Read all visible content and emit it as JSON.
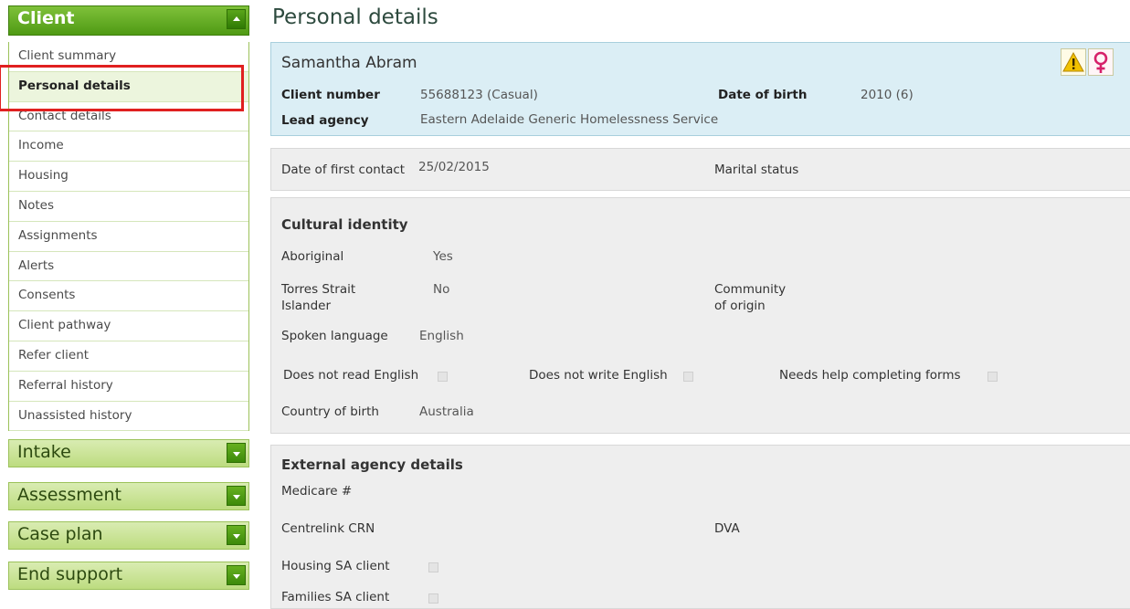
{
  "sidebar": {
    "client_header": "Client",
    "client_items": [
      {
        "label": "Client summary"
      },
      {
        "label": "Personal details"
      },
      {
        "label": "Contact details"
      },
      {
        "label": "Income"
      },
      {
        "label": "Housing"
      },
      {
        "label": "Notes"
      },
      {
        "label": "Assignments"
      },
      {
        "label": "Alerts"
      },
      {
        "label": "Consents"
      },
      {
        "label": "Client pathway"
      },
      {
        "label": "Refer client"
      },
      {
        "label": "Referral history"
      },
      {
        "label": "Unassisted history"
      }
    ],
    "intake": "Intake",
    "assessment": "Assessment",
    "case_plan": "Case plan",
    "end_support": "End support"
  },
  "page_title": "Personal details",
  "summary": {
    "name": "Samantha Abram",
    "client_number_label": "Client number",
    "client_number": "55688123 (Casual)",
    "dob_label": "Date of birth",
    "dob": "2010 (6)",
    "lead_agency_label": "Lead agency",
    "lead_agency": "Eastern Adelaide Generic Homelessness Service",
    "icons": [
      "warning-icon",
      "female-icon"
    ]
  },
  "first_contact": {
    "label": "Date of first contact",
    "value": "25/02/2015",
    "marital_label": "Marital status",
    "marital_value": ""
  },
  "cultural": {
    "heading": "Cultural identity",
    "aboriginal_label": "Aboriginal",
    "aboriginal_value": "Yes",
    "tsi_label_1": "Torres Strait",
    "tsi_label_2": "Islander",
    "tsi_value": "No",
    "community_label_1": "Community",
    "community_label_2": "of origin",
    "language_label": "Spoken language",
    "language_value": "English",
    "not_read": "Does not read English",
    "not_write": "Does not write English",
    "needs_help": "Needs help completing forms",
    "country_label": "Country of birth",
    "country_value": "Australia"
  },
  "external": {
    "heading": "External agency details",
    "medicare_label": "Medicare #",
    "centrelink_label": "Centrelink CRN",
    "dva_label": "DVA",
    "housing_sa_label": "Housing SA client",
    "families_sa_label": "Families SA client"
  },
  "colors": {
    "accent_green": "#4f9a14",
    "highlight_red": "#e02020",
    "summary_bg": "#dbeef5"
  }
}
